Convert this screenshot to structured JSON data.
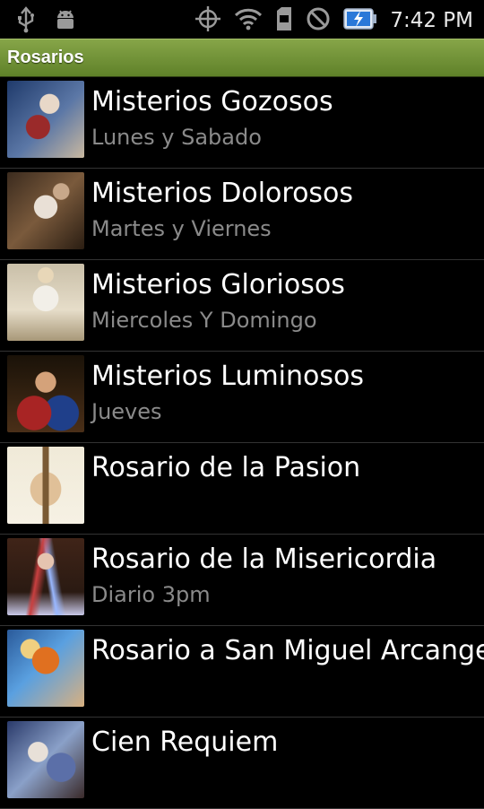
{
  "status_bar": {
    "icons_left": [
      "usb-icon",
      "android-debug-icon"
    ],
    "icons_right": [
      "gps-icon",
      "wifi-icon",
      "sd-card-icon",
      "no-sound-icon",
      "battery-charging-icon"
    ],
    "time": "7:42 PM"
  },
  "title_bar": {
    "title": "Rosarios",
    "color": "#6f9136"
  },
  "list": {
    "items": [
      {
        "title": "Misterios Gozosos",
        "subtitle": "Lunes y Sabado"
      },
      {
        "title": "Misterios Dolorosos",
        "subtitle": "Martes y Viernes"
      },
      {
        "title": "Misterios Gloriosos",
        "subtitle": "Miercoles Y Domingo"
      },
      {
        "title": "Misterios Luminosos",
        "subtitle": "Jueves"
      },
      {
        "title": "Rosario de la Pasion",
        "subtitle": ""
      },
      {
        "title": "Rosario de la Misericordia",
        "subtitle": "Diario 3pm"
      },
      {
        "title": "Rosario a San Miguel Arcangel",
        "subtitle": ""
      },
      {
        "title": "Cien Requiem",
        "subtitle": ""
      }
    ]
  }
}
